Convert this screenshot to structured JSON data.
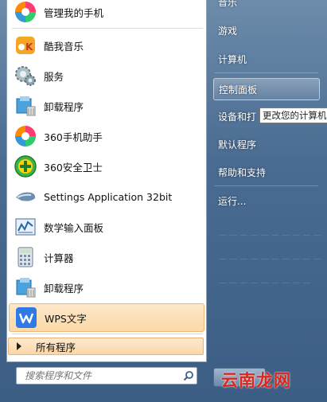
{
  "left_menu": {
    "items": [
      {
        "label": "管理我的手机",
        "icon": "phone-manager-icon"
      },
      {
        "label": "酷我音乐",
        "icon": "kuwo-music-icon"
      },
      {
        "label": "服务",
        "icon": "services-gear-icon"
      },
      {
        "label": "卸载程序",
        "icon": "uninstall-icon"
      },
      {
        "label": "360手机助手",
        "icon": "360-phone-assistant-icon"
      },
      {
        "label": "360安全卫士",
        "icon": "360-security-icon"
      },
      {
        "label": "Settings Application 32bit",
        "icon": "settings-app-icon"
      },
      {
        "label": "数学输入面板",
        "icon": "math-input-panel-icon"
      },
      {
        "label": "计算器",
        "icon": "calculator-icon"
      },
      {
        "label": "卸载程序",
        "icon": "uninstall-icon"
      },
      {
        "label": "WPS文字",
        "icon": "wps-writer-icon"
      }
    ],
    "all_programs": "所有程序",
    "search_placeholder": "搜索程序和文件"
  },
  "right_menu": {
    "items": [
      {
        "label": "音乐"
      },
      {
        "label": "游戏"
      },
      {
        "label": "计算机"
      },
      {
        "label": "控制面板"
      },
      {
        "label": "设备和打"
      },
      {
        "label": "默认程序"
      },
      {
        "label": "帮助和支持"
      },
      {
        "label": "运行..."
      }
    ],
    "tooltip": "更改您的计算机"
  },
  "watermark": "云南龙网",
  "colors": {
    "highlight": "#fcd9a8",
    "watermark": "#d8271c"
  }
}
